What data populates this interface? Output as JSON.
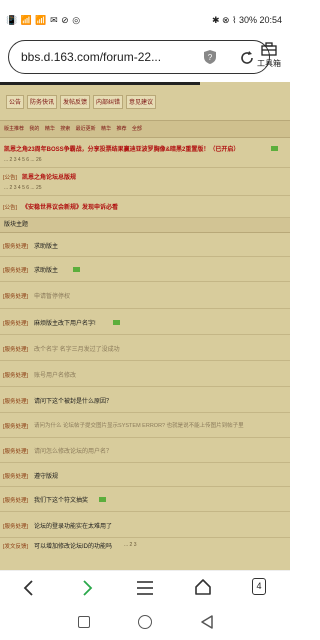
{
  "status": {
    "left": "📳 📶 📶 ✉ ⊘ ◎",
    "right": "✱ ⊗ ⌇ 30% 20:54"
  },
  "browser": {
    "url": "bbs.d.163.com/forum-22...",
    "toolbox": "工具箱",
    "tab_count": "4",
    "progress": 0.69
  },
  "tabs": [
    "公告",
    "防务快讯",
    "发帖反馈",
    "内部纠错",
    "意见建议"
  ],
  "strip": [
    "版主推荐",
    "我的",
    "精华",
    "搜索",
    "最近更新",
    "精华",
    "推荐",
    "全部"
  ],
  "announcements": [
    {
      "text": "凯恩之角23周年BOSS争霸战，分享投票结果赢迪亚波罗胸像&暗黑2重置版！（已开启）",
      "pages": "... 2 3 4 5 6 ... 26",
      "style": "red"
    },
    {
      "tag": "[公告]",
      "text": "凯恩之角论坛总版规",
      "pages": "... 2 3 4 5 6 ... 25",
      "style": "red"
    },
    {
      "tag": "[公告]",
      "text": "《安稳世界议会新规》发现申诉必看",
      "style": "red"
    }
  ],
  "section_title": "版块主题",
  "threads": [
    {
      "tag": "[服务处理]",
      "text": "求助版主",
      "style": ""
    },
    {
      "tag": "[服务处理]",
      "text": "求助版主",
      "style": "",
      "new": true
    },
    {
      "tag": "[服务处理]",
      "text": "申请暂停停权",
      "style": "dim"
    },
    {
      "tag": "[服务处理]",
      "text": "麻烦版主改下用户名字!",
      "style": "",
      "new": true
    },
    {
      "tag": "[服务处理]",
      "text": "改个名字 名字三月发过了没成功",
      "style": "dim"
    },
    {
      "tag": "[服务处理]",
      "text": "账号用户名修改",
      "style": "dim"
    },
    {
      "tag": "[服务处理]",
      "text": "请问下这个被封是什么原因？",
      "style": ""
    },
    {
      "tag": "[服务处理]",
      "text": "请问为什么 论坛帖子提交图片显示SYSTEM ERROR? 也就是说不能上传图片到帖子里",
      "style": "dim"
    },
    {
      "tag": "[服务处理]",
      "text": "请问怎么修改论坛的用户名？",
      "style": "dim"
    },
    {
      "tag": "[服务处理]",
      "text": "遵守版规",
      "style": ""
    },
    {
      "tag": "[服务处理]",
      "text": "我们下这个符文抽奖",
      "style": "",
      "new": true
    },
    {
      "tag": "[服务处理]",
      "text": "论坛的登录功能实在太难用了",
      "style": "",
      "new": true
    },
    {
      "tag": "[发文反馈]",
      "text": "可以增加修改论坛ID的功能吗",
      "style": "",
      "pages": "... 2 3"
    }
  ]
}
